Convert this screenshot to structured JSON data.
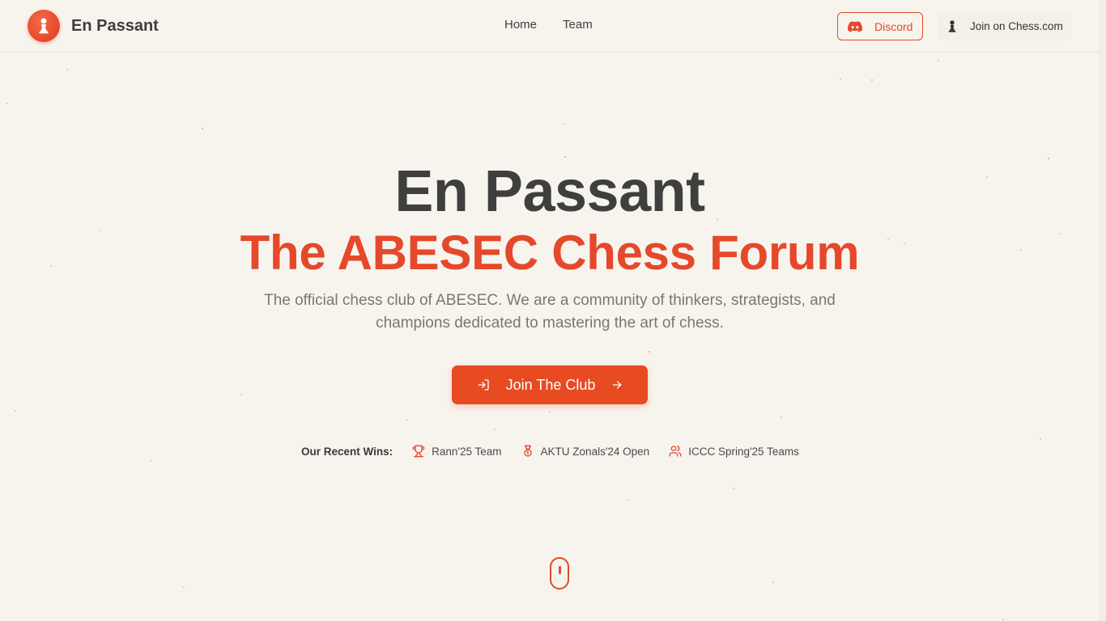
{
  "header": {
    "brand": "En Passant",
    "nav": [
      "Home",
      "Team"
    ],
    "discord_label": "Discord",
    "chess_label": "Join on Chess.com"
  },
  "hero": {
    "title": "En Passant",
    "subtitle": "The ABESEC Chess Forum",
    "description": "The official chess club of ABESEC. We are a community of thinkers, strategists, and champions dedicated to mastering the art of chess.",
    "cta_label": "Join The Club"
  },
  "wins": {
    "heading": "Our Recent Wins:",
    "items": [
      {
        "label": "Rann'25 Team",
        "icon": "trophy-icon"
      },
      {
        "label": "AKTU Zonals'24 Open",
        "icon": "medal-icon"
      },
      {
        "label": "ICCC Spring'25 Teams",
        "icon": "users-icon"
      }
    ]
  },
  "colors": {
    "accent": "#e5482a",
    "background": "#f7f4ee",
    "text": "#3f3f3d",
    "muted": "#7a7670"
  }
}
